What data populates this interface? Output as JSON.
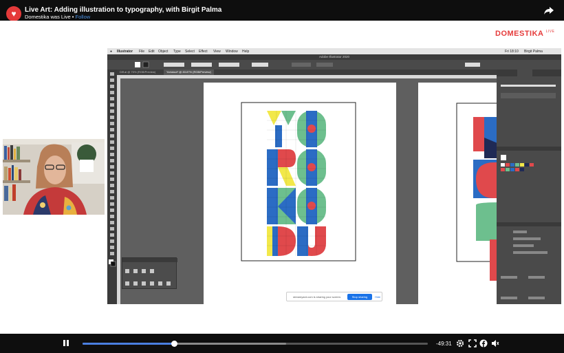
{
  "video": {
    "title": "Live Art: Adding illustration to typography, with Birgit Palma",
    "subtitle": "Domestika was Live",
    "follow_label": "Follow",
    "channel_icon": "domestika-heart-icon"
  },
  "brand": {
    "name": "DOMESTIKA",
    "badge": "LIVE"
  },
  "illustrator": {
    "app_menu": [
      "Illustrator",
      "File",
      "Edit",
      "Object",
      "Type",
      "Select",
      "Effect",
      "View",
      "Window",
      "Help"
    ],
    "clock": "Fri 18:10",
    "user": "Birgit Palma",
    "window_title": "Adobe Illustrator 2020",
    "tabs": [
      "Diff.ai @ 75% (RGB/Preview)",
      "Yorkdout* @ 83.87% (RGB/Preview)"
    ],
    "panels": [
      "Artboards",
      "Brushes",
      "Layers"
    ],
    "artwork_letters": [
      "YO",
      "RO",
      "KO",
      "DU"
    ]
  },
  "share_bar": {
    "message": "streamyard.com is sharing your screen.",
    "stop_label": "Stop sharing",
    "hide_label": "Hide"
  },
  "player": {
    "time_remaining": "-49:31",
    "progress": 0.265,
    "buffered": 0.59
  },
  "colors": {
    "accent": "#e53a3a",
    "progress": "#4a7fe0",
    "art_blue": "#2b6cc4",
    "art_green": "#6dbf8e",
    "art_red": "#e0494c",
    "art_yellow": "#f2e84a",
    "art_navy": "#1f2a55"
  }
}
